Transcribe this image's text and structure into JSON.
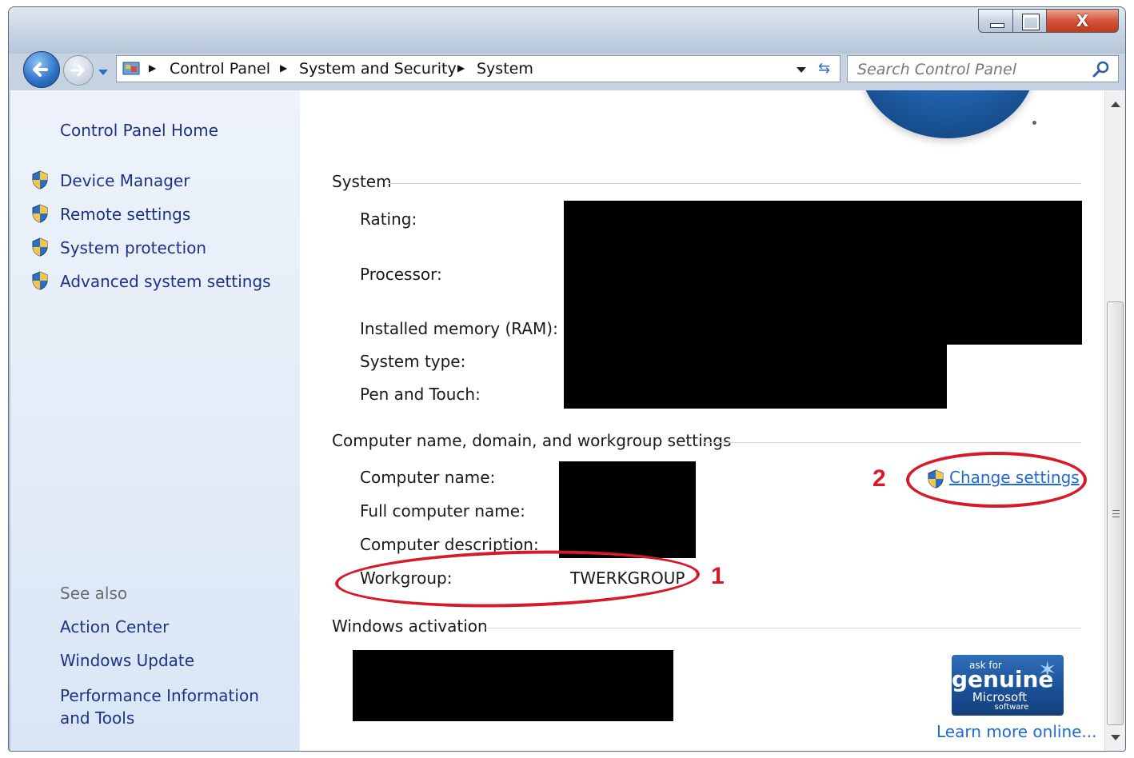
{
  "window": {
    "close_glyph": "X"
  },
  "address_bar": {
    "breadcrumbs": [
      "Control Panel",
      "System and Security",
      "System"
    ]
  },
  "search": {
    "placeholder": "Search Control Panel"
  },
  "sidebar": {
    "home": "Control Panel Home",
    "tasks": [
      "Device Manager",
      "Remote settings",
      "System protection",
      "Advanced system settings"
    ],
    "see_also_title": "See also",
    "see_also": [
      "Action Center",
      "Windows Update",
      "Performance Information and Tools"
    ]
  },
  "system_section": {
    "title": "System",
    "labels": [
      "Rating:",
      "Processor:",
      "Installed memory (RAM):",
      "System type:",
      "Pen and Touch:"
    ]
  },
  "computer_section": {
    "title": "Computer name, domain, and workgroup settings",
    "labels": [
      "Computer name:",
      "Full computer name:",
      "Computer description:",
      "Workgroup:"
    ],
    "workgroup_value": "TWERKGROUP",
    "change_settings": "Change settings"
  },
  "activation_section": {
    "title": "Windows activation",
    "genuine_ask": "ask for",
    "genuine_big": "genuine",
    "genuine_ms": "Microsoft",
    "genuine_sw": "software",
    "learn_more": "Learn more online..."
  },
  "annotations": {
    "marker_1": "1",
    "marker_2": "2"
  },
  "colors": {
    "link": "#1e6ad6",
    "nav_link": "#1e3287",
    "annotation_red": "#d8192a"
  }
}
